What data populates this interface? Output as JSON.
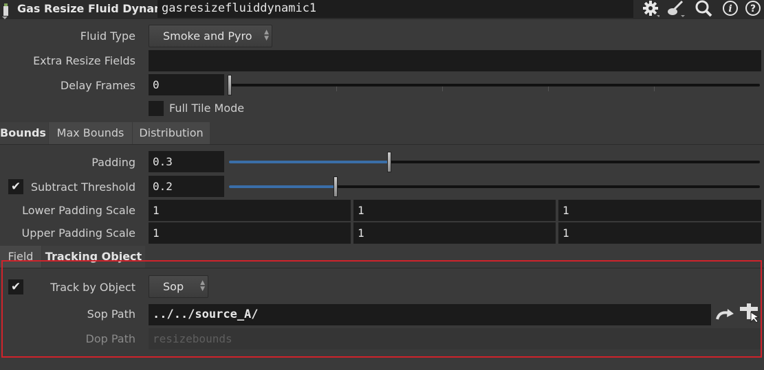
{
  "header": {
    "node_type": "Gas Resize Fluid Dynamic",
    "node_name": "gasresizefluiddynamic1",
    "icons": [
      "gear-icon",
      "paintbrush-icon",
      "magnifier-icon",
      "info-icon",
      "help-icon"
    ]
  },
  "params": {
    "fluid_type": {
      "label": "Fluid Type",
      "value": "Smoke and Pyro"
    },
    "extra_resize_fields": {
      "label": "Extra Resize Fields",
      "value": ""
    },
    "delay_frames": {
      "label": "Delay Frames",
      "value": "0"
    },
    "full_tile_mode": {
      "label": "Full Tile Mode",
      "checked": false
    }
  },
  "bounds_tabs": [
    "Bounds",
    "Max Bounds",
    "Distribution"
  ],
  "bounds": {
    "padding": {
      "label": "Padding",
      "value": "0.3"
    },
    "subtract_threshold": {
      "label": "Subtract Threshold",
      "value": "0.2",
      "checked": true
    },
    "lower_padding_scale": {
      "label": "Lower Padding Scale",
      "values": [
        "1",
        "1",
        "1"
      ]
    },
    "upper_padding_scale": {
      "label": "Upper Padding Scale",
      "values": [
        "1",
        "1",
        "1"
      ]
    }
  },
  "tracking_tabs": [
    "Field",
    "Tracking Object"
  ],
  "tracking": {
    "track_by_object": {
      "label": "Track by Object",
      "value": "Sop",
      "checked": true
    },
    "sop_path": {
      "label": "Sop Path",
      "value": "../../source_A/"
    },
    "dop_path": {
      "label": "Dop Path",
      "value": "resizebounds"
    }
  },
  "colors": {
    "highlight_box": "#d0232b",
    "slider_fill": "#3a6ea8"
  }
}
